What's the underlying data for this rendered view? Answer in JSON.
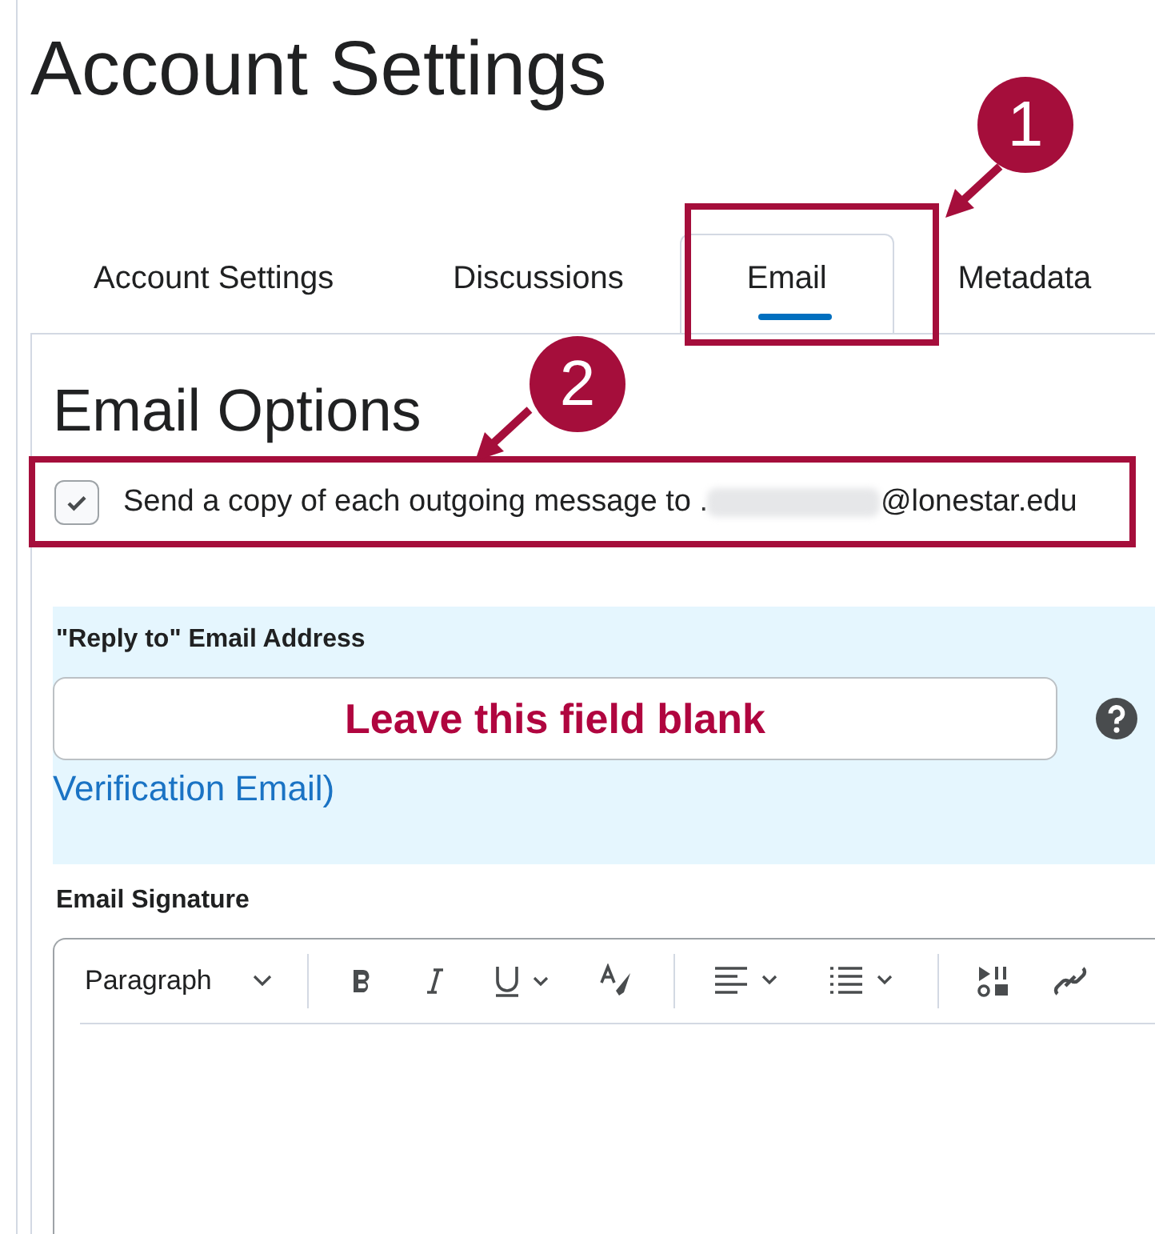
{
  "page": {
    "title": "Account Settings"
  },
  "tabs": [
    {
      "label": "Account Settings",
      "selected": false
    },
    {
      "label": "Discussions",
      "selected": false
    },
    {
      "label": "Email",
      "selected": true
    },
    {
      "label": "Metadata",
      "selected": false
    }
  ],
  "email_options": {
    "heading": "Email Options",
    "copy_option": {
      "checked": true,
      "label": "Send a copy of each outgoing message to .",
      "domain": "@lonestar.edu"
    }
  },
  "reply_to": {
    "label": "\"Reply to\" Email Address",
    "placeholder": "Leave this field blank",
    "link": "Verification Email)"
  },
  "signature": {
    "label": "Email Signature",
    "format_select": "Paragraph"
  },
  "annotations": [
    {
      "number": "1"
    },
    {
      "number": "2"
    }
  ]
}
